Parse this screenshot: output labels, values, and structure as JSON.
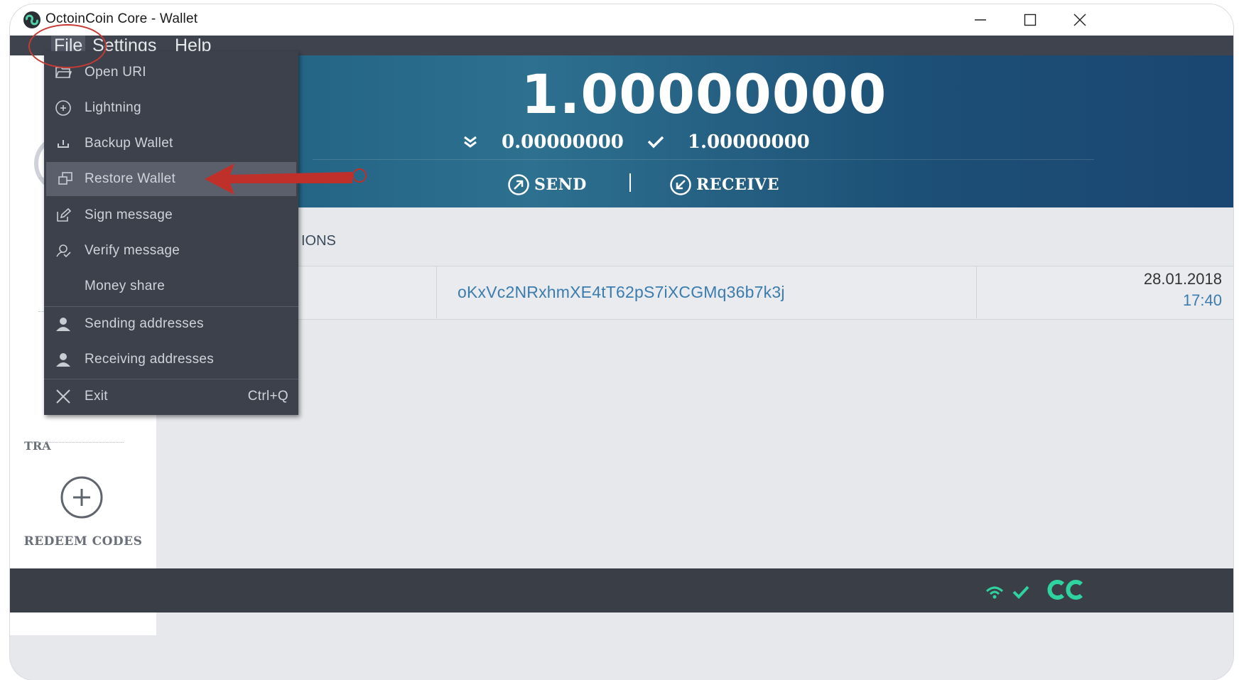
{
  "window": {
    "title": "OctoinCoin Core - Wallet",
    "minimize_icon": "minimize-icon",
    "maximize_icon": "maximize-icon",
    "close_icon": "close-icon"
  },
  "menubar": {
    "file": "File",
    "settings": "Settings",
    "help": "Help"
  },
  "file_menu": {
    "items": [
      {
        "label": "Open URI",
        "icon": "folder-open-icon"
      },
      {
        "label": "Lightning",
        "icon": "plus-circle-icon"
      },
      {
        "label": "Backup Wallet",
        "icon": "backup-icon"
      },
      {
        "label": "Restore Wallet",
        "icon": "restore-icon",
        "highlighted": true
      },
      {
        "label": "Sign message",
        "icon": "edit-icon"
      },
      {
        "label": "Verify message",
        "icon": "verify-icon"
      },
      {
        "label": "Money share",
        "icon": ""
      },
      {
        "label": "Sending addresses",
        "icon": "user-icon"
      },
      {
        "label": "Receiving addresses",
        "icon": "user-icon"
      },
      {
        "label": "Exit",
        "icon": "close-icon",
        "shortcut": "Ctrl+Q"
      }
    ]
  },
  "balance": {
    "total": "1.00000000",
    "pending": "0.00000000",
    "confirmed": "1.00000000"
  },
  "actions": {
    "send": "SEND",
    "receive": "RECEIVE"
  },
  "section": {
    "title_visible": "IONS"
  },
  "sidebar": {
    "transactions_partial": "TRA",
    "redeem_label": "REDEEM CODES"
  },
  "transactions": [
    {
      "address": "oKxVc2NRxhmXE4tT62pS7iXCGMq36b7k3j",
      "date": "28.01.2018",
      "time": "17:40"
    }
  ],
  "colors": {
    "header_gradient_start": "#1f5e80",
    "header_gradient_end": "#1a4672",
    "menubar": "#3f434d",
    "dropdown": "#3d414c",
    "highlight_row": "#5a5f6b",
    "annotation_red": "#c43a35",
    "status_green": "#2fd3a0",
    "link_blue": "#3b7cae"
  },
  "status_icons": [
    "wifi-icon",
    "check-icon",
    "octoin-logo-icon"
  ]
}
